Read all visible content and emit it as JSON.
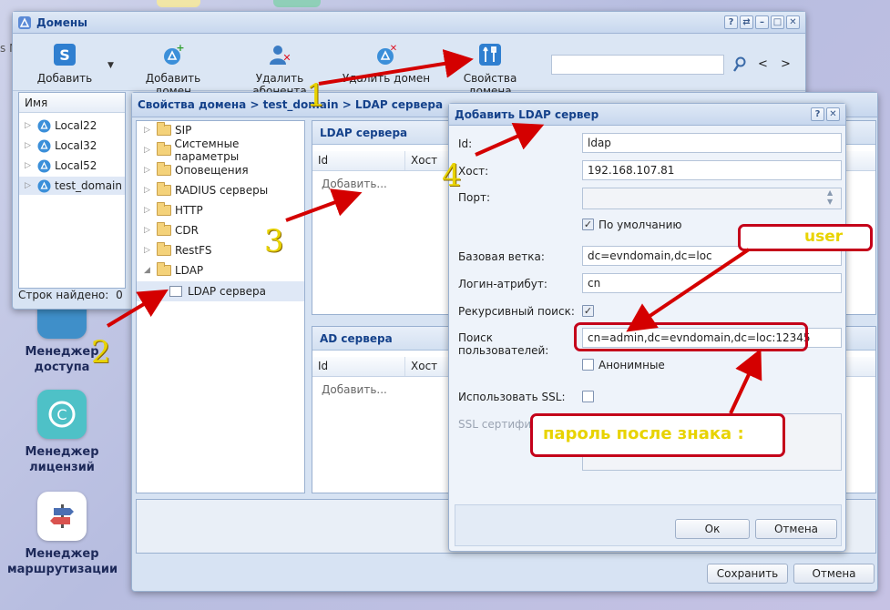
{
  "desktop": {
    "icons": [
      {
        "label_1": "Менеджер",
        "label_2": "доступа"
      },
      {
        "label_1": "Менеджер",
        "label_2": "лицензий"
      },
      {
        "label_1": "Менеджер",
        "label_2": "маршрутизации"
      }
    ],
    "edge_fragment": "s M"
  },
  "domains_window": {
    "title": "Домены",
    "toolbar": {
      "add": "Добавить",
      "add_domain": "Добавить домен",
      "delete_subscriber": "Удалить абонента",
      "delete_domain": "Удалить домен",
      "domain_properties": "Свойства домена"
    },
    "search": {
      "value": "",
      "placeholder": ""
    },
    "pager": {
      "prev": "<",
      "next": ">"
    },
    "tree_header": "Имя",
    "domains": [
      "Local22",
      "Local32",
      "Local52",
      "test_domain"
    ],
    "status": {
      "label": "Строк найдено:",
      "count": "0"
    }
  },
  "props_window": {
    "title": "Свойства домена > test_domain > LDAP сервера",
    "tree": [
      "SIP",
      "Системные параметры",
      "Оповещения",
      "RADIUS серверы",
      "HTTP",
      "CDR",
      "RestFS",
      "LDAP"
    ],
    "tree_child": "LDAP сервера",
    "ldap_section": {
      "title": "LDAP сервера",
      "col_id": "Id",
      "col_host": "Хост",
      "add": "Добавить..."
    },
    "ad_section": {
      "title": "AD сервера",
      "col_id": "Id",
      "col_host": "Хост",
      "add": "Добавить..."
    },
    "save": "Сохранить",
    "cancel": "Отмена"
  },
  "add_ldap_dialog": {
    "title": "Добавить LDAP сервер",
    "fields": {
      "id_label": "Id:",
      "id_value": "ldap",
      "host_label": "Хост:",
      "host_value": "192.168.107.81",
      "port_label": "Порт:",
      "port_value": "",
      "default_label": "По умолчанию",
      "base_label": "Базовая ветка:",
      "base_value": "dc=evndomain,dc=loc",
      "login_label": "Логин-атрибут:",
      "login_value": "cn",
      "recursive_label": "Рекурсивный поиск:",
      "search_label_1": "Поиск",
      "search_label_2": "пользователей:",
      "search_value": "cn=admin,dc=evndomain,dc=loc:12345",
      "anonymous_label": "Анонимные",
      "ssl_label": "Использовать SSL:",
      "ssl_cert_label": "SSL сертификат:"
    },
    "ok": "Ок",
    "cancel": "Отмена"
  },
  "annotations": {
    "steps": [
      "1",
      "2",
      "3",
      "4"
    ],
    "user_note": "user",
    "password_note": "пароль после знака :",
    "arrow_color": "#d40000",
    "box_color": "#c4001a",
    "note_color": "#e8d300"
  }
}
